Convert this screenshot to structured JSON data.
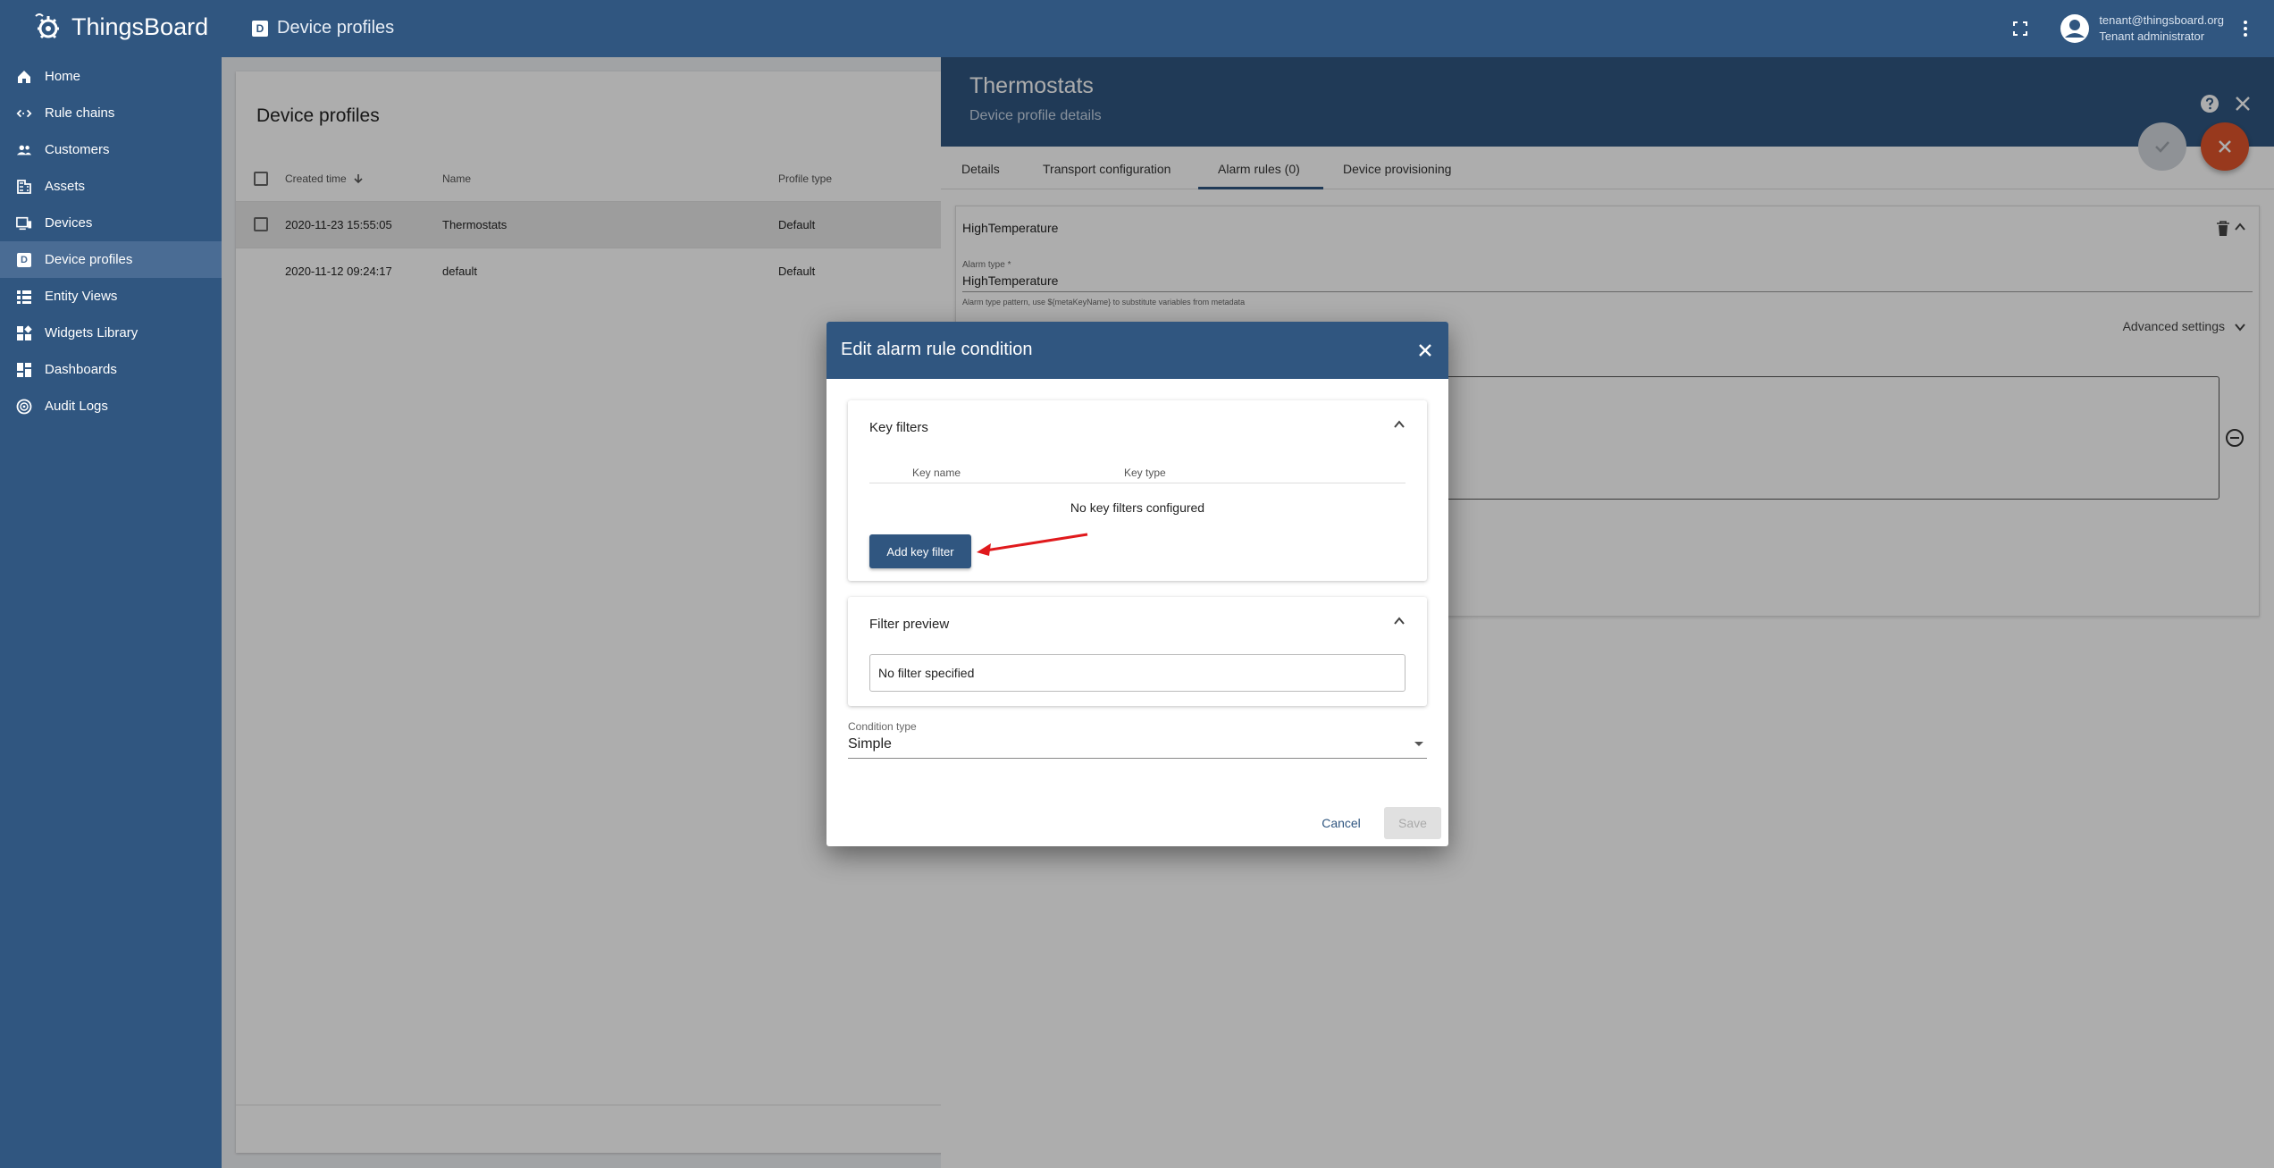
{
  "app": {
    "name": "ThingsBoard"
  },
  "topbar": {
    "breadcrumb": "Device profiles",
    "breadcrumb_icon": "device-profile-icon",
    "user_email": "tenant@thingsboard.org",
    "user_role": "Tenant administrator"
  },
  "sidebar": {
    "items": [
      {
        "label": "Home",
        "icon": "home-icon",
        "active": false
      },
      {
        "label": "Rule chains",
        "icon": "rule-chains-icon",
        "active": false
      },
      {
        "label": "Customers",
        "icon": "customers-icon",
        "active": false
      },
      {
        "label": "Assets",
        "icon": "assets-icon",
        "active": false
      },
      {
        "label": "Devices",
        "icon": "devices-icon",
        "active": false
      },
      {
        "label": "Device profiles",
        "icon": "device-profile-icon",
        "active": true
      },
      {
        "label": "Entity Views",
        "icon": "entity-views-icon",
        "active": false
      },
      {
        "label": "Widgets Library",
        "icon": "widgets-icon",
        "active": false
      },
      {
        "label": "Dashboards",
        "icon": "dashboards-icon",
        "active": false
      },
      {
        "label": "Audit Logs",
        "icon": "audit-logs-icon",
        "active": false
      }
    ]
  },
  "list": {
    "title": "Device profiles",
    "columns": {
      "created": "Created time",
      "name": "Name",
      "type": "Profile type"
    },
    "rows": [
      {
        "created": "2020-11-23 15:55:05",
        "name": "Thermostats",
        "type": "Default",
        "selected": true
      },
      {
        "created": "2020-11-12 09:24:17",
        "name": "default",
        "type": "Default",
        "selected": false
      }
    ]
  },
  "panel": {
    "title": "Thermostats",
    "subtitle": "Device profile details",
    "tabs": [
      "Details",
      "Transport configuration",
      "Alarm rules (0)",
      "Device provisioning"
    ],
    "active_tab": 2,
    "alarm": {
      "name": "HighTemperature",
      "type_label": "Alarm type *",
      "type_value": "HighTemperature",
      "hint": "Alarm type pattern, use ${metaKeyName} to substitute variables from metadata",
      "advanced": "Advanced settings"
    }
  },
  "dialog": {
    "title": "Edit alarm rule condition",
    "key_filters": {
      "title": "Key filters",
      "col_name": "Key name",
      "col_type": "Key type",
      "empty": "No key filters configured",
      "add_button": "Add key filter"
    },
    "filter_preview": {
      "title": "Filter preview",
      "value": "No filter specified"
    },
    "condition_type": {
      "label": "Condition type",
      "value": "Simple"
    },
    "cancel": "Cancel",
    "save": "Save"
  },
  "colors": {
    "primary": "#305680",
    "accent_fab": "#e0542b",
    "annotation_arrow": "#e0191c"
  }
}
